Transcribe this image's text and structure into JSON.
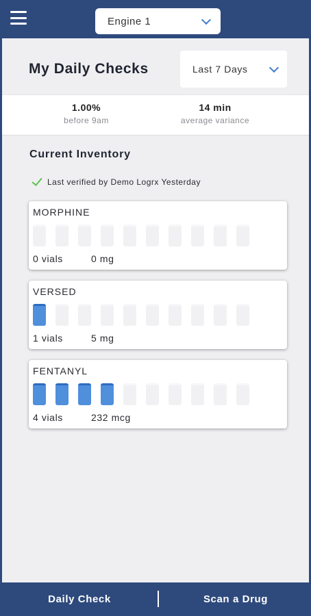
{
  "header": {
    "engine_select": "Engine 1"
  },
  "page": {
    "title": "My Daily Checks",
    "range_select": "Last 7 Days"
  },
  "stats": [
    {
      "value": "1.00%",
      "label": "before 9am"
    },
    {
      "value": "14 min",
      "label": "average variance"
    }
  ],
  "inventory": {
    "title": "Current Inventory",
    "verified_text": "Last verified by Demo Logrx Yesterday",
    "capacity": 10,
    "items": [
      {
        "name": "MORPHINE",
        "vials": 0,
        "vials_text": "0 vials",
        "amount_text": "0 mg"
      },
      {
        "name": "VERSED",
        "vials": 1,
        "vials_text": "1 vials",
        "amount_text": "5 mg"
      },
      {
        "name": "FENTANYL",
        "vials": 4,
        "vials_text": "4 vials",
        "amount_text": "232 mcg"
      }
    ]
  },
  "footer": {
    "daily_check": "Daily Check",
    "scan_drug": "Scan a Drug"
  },
  "colors": {
    "nav": "#2e4a7d",
    "vial_filled": "#4f8fdc",
    "check": "#5cc04e"
  },
  "icons": [
    "menu-icon",
    "chevron-down-icon",
    "checkmark-icon"
  ]
}
